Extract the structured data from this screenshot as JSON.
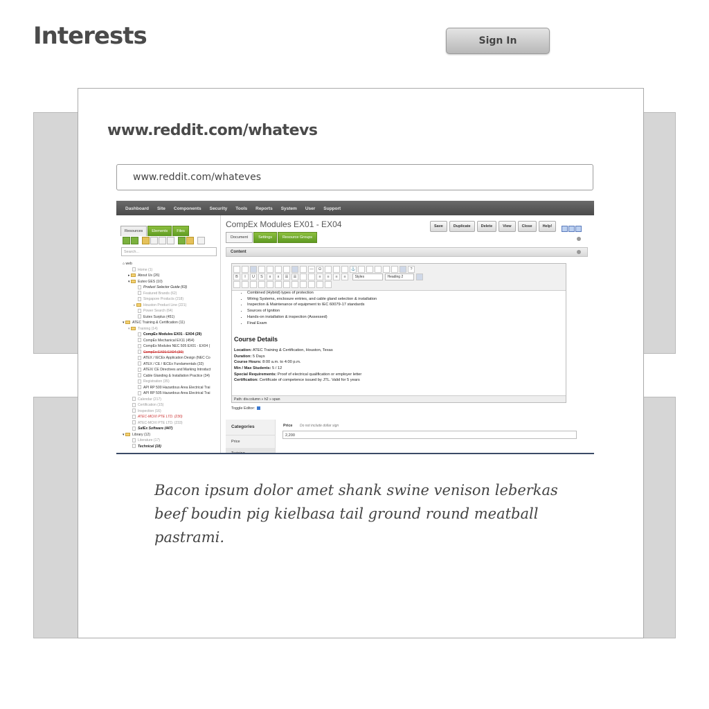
{
  "page": {
    "title": "Interests",
    "signin_label": "Sign In"
  },
  "card": {
    "title": "www.reddit.com/whatevs",
    "url_value": "www.reddit.com/whateves",
    "caption": "Bacon ipsum dolor amet shank swine venison leberkas beef boudin pig kielbasa tail ground round meatball pastrami."
  },
  "cms": {
    "nav": [
      "Dashboard",
      "Site",
      "Components",
      "Security",
      "Tools",
      "Reports",
      "System",
      "User",
      "Support"
    ],
    "sidebar_tabs": [
      "Resources",
      "Elements",
      "Files"
    ],
    "search_placeholder": "Search...",
    "tree": [
      {
        "label": "web"
      },
      {
        "label": "Home (1)"
      },
      {
        "label": "About Us (26)"
      },
      {
        "label": "Eutex GES (10)"
      },
      {
        "label": "Product Selector Guide (63)"
      },
      {
        "label": "Featured Brands (62)"
      },
      {
        "label": "Singapore Products (218)"
      },
      {
        "label": "Houston Product Line (221)"
      },
      {
        "label": "Power Search (64)"
      },
      {
        "label": "Eutex Surplus (451)"
      },
      {
        "label": "ATEC Training & Certification (11)"
      },
      {
        "label": "Training (14)"
      },
      {
        "label": "CompEx Modules EX01 - EX04 (29)"
      },
      {
        "label": "CompEx Mechanical EX11 (454)"
      },
      {
        "label": "CompEx Modules NEC 505 EX01 - EX04 ("
      },
      {
        "label": "CompEx EX01-EX04 (30)"
      },
      {
        "label": "ATEX / IECEx Application Design (NEC Co"
      },
      {
        "label": "ATEX / CE / IECEx Fundamentals (32)"
      },
      {
        "label": "ATEX/ CE Directives and Marking Introduct"
      },
      {
        "label": "Cable Glanding & Installation Practice (34)"
      },
      {
        "label": "Registration (35)"
      },
      {
        "label": "API RP 500 Hazardous Area Electrical Trai"
      },
      {
        "label": "API RP 505 Hazardous Area Electrical Trai"
      },
      {
        "label": "Calendar (217)"
      },
      {
        "label": "Certification (15)"
      },
      {
        "label": "Inspection (16)"
      },
      {
        "label": "ATEC-MOXI PTE LTD. (230)"
      },
      {
        "label": "ATEC-MOXI PTE LTD. (233)"
      },
      {
        "label": "SafEx Software (447)"
      },
      {
        "label": "Library (12)"
      },
      {
        "label": "Literature (17)"
      },
      {
        "label": "Technical (18)"
      }
    ],
    "resource_title": "CompEx Modules EX01 - EX04",
    "action_buttons": [
      "Save",
      "Duplicate",
      "Delete",
      "View",
      "Close",
      "Help!"
    ],
    "doc_tabs": [
      "Document",
      "Settings",
      "Resource Groups"
    ],
    "content_label": "Content",
    "styles_select": "Styles",
    "heading_select": "Heading 2",
    "bullets": [
      "Combined (Hybrid) types of protection",
      "Wiring Systems, enclosure entries, and cable gland selection & installation",
      "Inspection & Maintenance of equipment to IEC 60079-17 standards",
      "Sources of Ignition",
      "Hands-on installation & inspection (Assessed)",
      "Final Exam"
    ],
    "course_heading": "Course Details",
    "details": [
      {
        "label": "Location:",
        "value": "ATEC Training & Certification, Houston, Texas"
      },
      {
        "label": "Duration:",
        "value": "5 Days"
      },
      {
        "label": "Course Hours:",
        "value": "8:00 a.m. to 4:00 p.m."
      },
      {
        "label": "Min / Max Students:",
        "value": "5 / 12"
      },
      {
        "label": "Special Requirements:",
        "value": "Proof of electrical qualification or employer letter"
      },
      {
        "label": "Certification:",
        "value": "Certificate of competence issued by JTL. Valid for 5 years"
      }
    ],
    "path": "Path: div.column » h2 » span",
    "toggle_editor": "Toggle Editor:",
    "categories": [
      "Categories",
      "Price",
      "Training"
    ],
    "price_label": "Price",
    "price_hint": "Do not include dollar sign",
    "price_value": "2,200"
  }
}
